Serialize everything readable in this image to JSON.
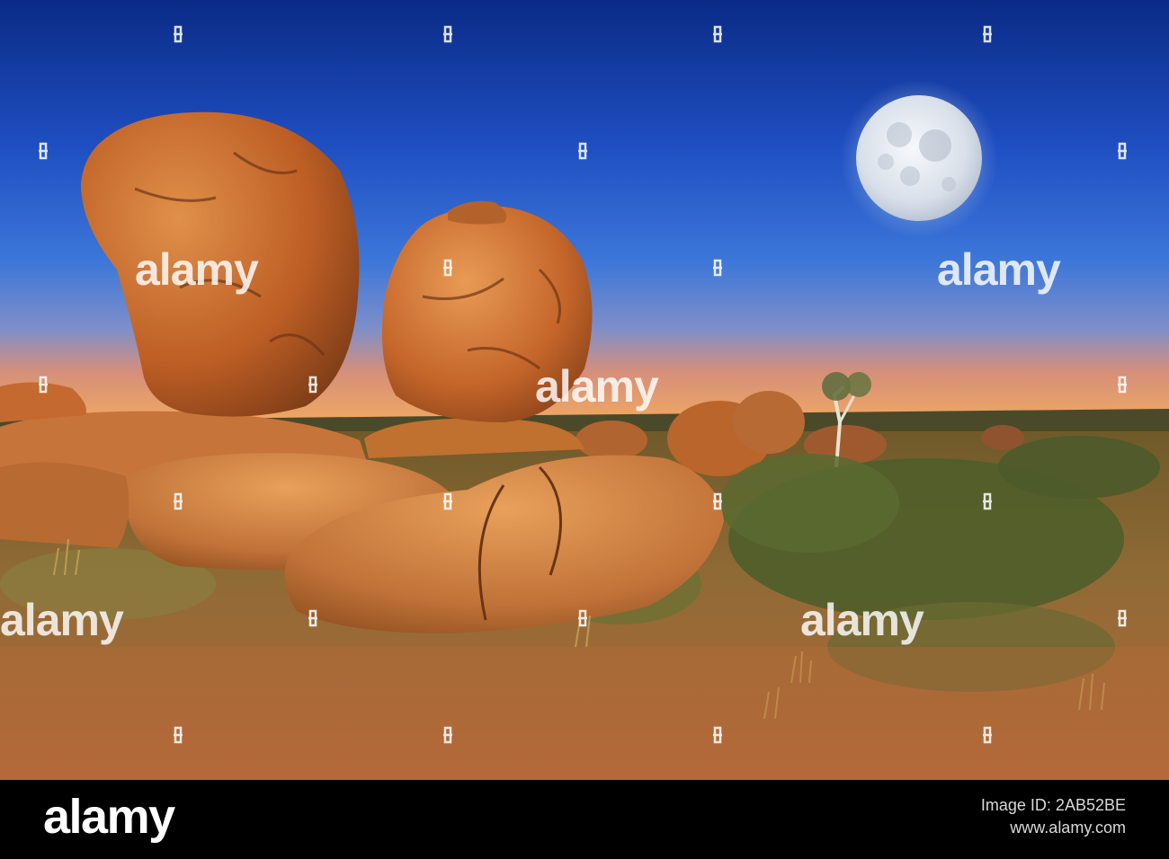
{
  "watermark": {
    "text": "alamy"
  },
  "footer": {
    "brand": "alamy",
    "line1": "Image ID: 2AB52BE",
    "line2": "www.alamy.com",
    "image_id": "2AB52BE"
  },
  "scene": {
    "sky_top": "#0b2f8c",
    "sky_mid": "#2356c9",
    "horizon": "#f2a15a",
    "rock": "#c2622a",
    "moon": "#e9eef6"
  }
}
